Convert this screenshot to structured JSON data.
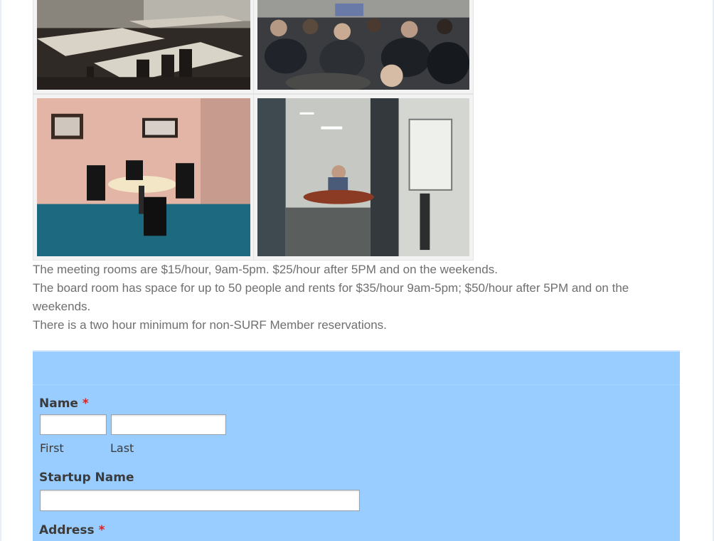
{
  "gallery": {
    "photos": [
      {
        "subject": "empty meeting room with tables and chairs"
      },
      {
        "subject": "audience seated at an event"
      },
      {
        "subject": "small conference room with round table"
      },
      {
        "subject": "office with person at round table and whiteboard"
      }
    ]
  },
  "info": {
    "line1": "The meeting rooms are $15/hour, 9am-5pm. $25/hour after 5PM and on the weekends.",
    "line2": "The board room has space for up to 50 people and rents for $35/hour 9am-5pm; $50/hour after 5PM and on the weekends.",
    "line3": "There is a two hour minimum for non-SURF Member reservations."
  },
  "form": {
    "background": "#99ccff",
    "required_mark": "*",
    "name_label": "Name",
    "first_sublabel": "First",
    "last_sublabel": "Last",
    "first_value": "",
    "last_value": "",
    "startup_label": "Startup Name",
    "startup_value": "",
    "address_label": "Address"
  }
}
